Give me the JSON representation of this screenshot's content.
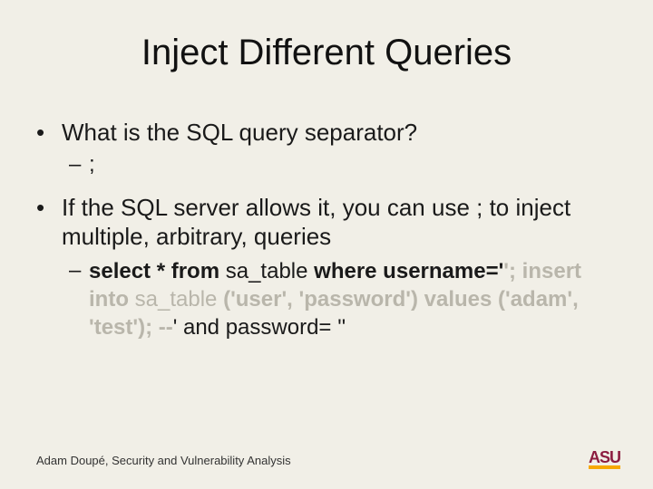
{
  "title": "Inject Different Queries",
  "bullets": {
    "b1": "What is the SQL query separator?",
    "b1a": ";",
    "b2": "If the SQL server allows it, you can use ; to inject multiple, arbitrary, queries",
    "b2a_strong1": "select * from ",
    "b2a_plain1": "sa_table",
    "b2a_strong2": " where username='",
    "b2a_gray1": "'; insert into ",
    "b2a_grayplain": "sa_table",
    "b2a_gray2": " ('user', 'password') values ('adam', 'test'); --",
    "b2a_plain2": "' and password= ''"
  },
  "footer": "Adam Doupé, Security and Vulnerability Analysis",
  "logo_text": "ASU"
}
